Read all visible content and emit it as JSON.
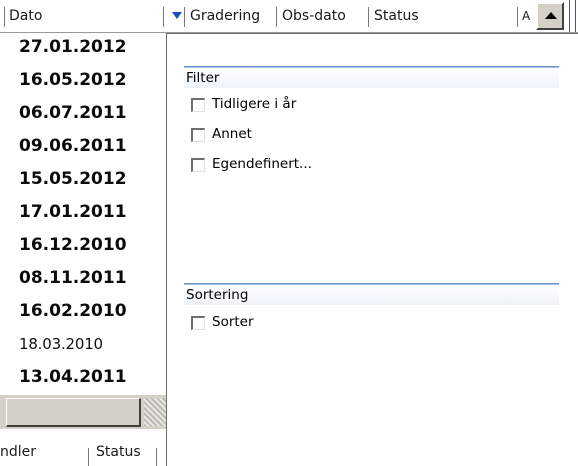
{
  "header": {
    "col_dato": "Dato",
    "col_gradering": "Gradering",
    "col_obsdato": "Obs-dato",
    "col_status": "Status",
    "col_more": "A"
  },
  "dates": [
    {
      "value": "27.01.2012",
      "bold": true
    },
    {
      "value": "16.05.2012",
      "bold": true
    },
    {
      "value": "06.07.2011",
      "bold": true
    },
    {
      "value": "09.06.2011",
      "bold": true
    },
    {
      "value": "15.05.2012",
      "bold": true
    },
    {
      "value": "17.01.2011",
      "bold": true
    },
    {
      "value": "16.12.2010",
      "bold": true
    },
    {
      "value": "08.11.2011",
      "bold": true
    },
    {
      "value": "16.02.2010",
      "bold": true
    },
    {
      "value": "18.03.2010",
      "bold": false
    },
    {
      "value": "13.04.2011",
      "bold": true
    }
  ],
  "bottom_header": {
    "col1": "ndler",
    "col2": "Status"
  },
  "panel": {
    "filter": {
      "title": "Filter",
      "options": [
        {
          "label": "Tidligere i år",
          "checked": false
        },
        {
          "label": "Annet",
          "checked": false
        },
        {
          "label": "Egendefinert...",
          "checked": false
        }
      ]
    },
    "sorting": {
      "title": "Sortering",
      "options": [
        {
          "label": "Sorter",
          "checked": false
        }
      ]
    }
  },
  "colors": {
    "accent": "#4b7ec7",
    "dropdown_arrow": "#1d4fbf",
    "chrome": "#d4d0c8"
  }
}
